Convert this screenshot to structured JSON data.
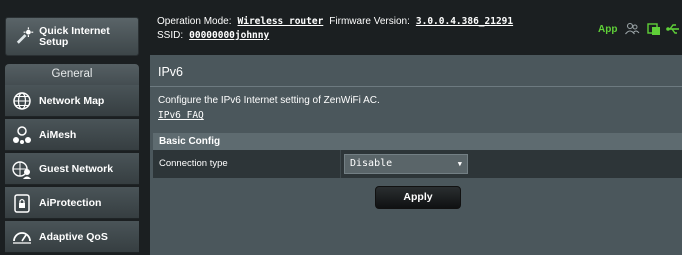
{
  "sidebar": {
    "quick_setup_label": "Quick Internet Setup",
    "general_label": "General",
    "items": [
      {
        "label": "Network Map",
        "icon": "globe-network-icon"
      },
      {
        "label": "AiMesh",
        "icon": "aimesh-icon"
      },
      {
        "label": "Guest Network",
        "icon": "guest-network-icon"
      },
      {
        "label": "AiProtection",
        "icon": "lock-shield-icon"
      },
      {
        "label": "Adaptive QoS",
        "icon": "speedometer-icon"
      }
    ]
  },
  "header": {
    "operation_mode_label": "Operation Mode:",
    "operation_mode_value": "Wireless router",
    "firmware_label": "Firmware Version:",
    "firmware_value": "3.0.0.4.386_21291",
    "ssid_label": "SSID:",
    "ssid_value": "00000000johnny",
    "app_label": "App"
  },
  "main": {
    "title": "IPv6",
    "description": "Configure the IPv6 Internet setting of ZenWiFi AC.",
    "faq_link": "IPv6 FAQ",
    "section_title": "Basic Config",
    "connection_type_label": "Connection type",
    "connection_type_value": "Disable",
    "apply_label": "Apply"
  },
  "colors": {
    "accent_green": "#5fd038",
    "panel_bg": "#4b575c",
    "frame_bg": "#1b1f21"
  }
}
